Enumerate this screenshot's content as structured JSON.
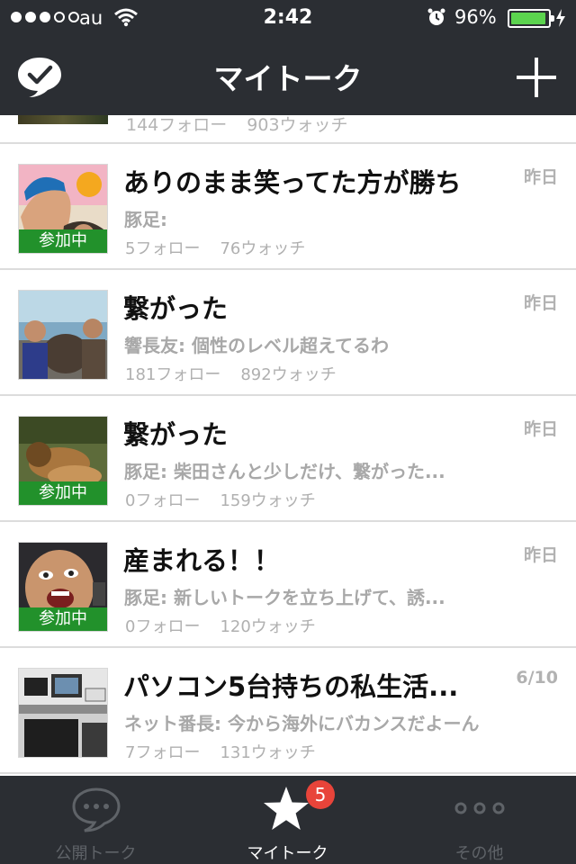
{
  "status_bar": {
    "carrier": "au",
    "time": "2:42",
    "battery_percent": "96%",
    "battery_level": 0.96,
    "signal_bars_filled": 3,
    "signal_bars_total": 5,
    "icons": [
      "wifi-icon",
      "alarm-icon",
      "charging-bolt-icon"
    ]
  },
  "nav_bar": {
    "title": "マイトーク",
    "left_icon": "check-bubble-icon",
    "right_icon": "plus-icon"
  },
  "partial_row": {
    "follow": "144フォロー",
    "watch": "903ウォッチ"
  },
  "talks": [
    {
      "title": "ありのまま笑ってた方が勝ち",
      "date": "昨日",
      "message": "豚足:",
      "follow": "5フォロー",
      "watch": "76ウォッチ",
      "badge": "参加中"
    },
    {
      "title": "繋がった",
      "date": "昨日",
      "message": "響長友: 個性のレベル超えてるわ",
      "follow": "181フォロー",
      "watch": "892ウォッチ",
      "badge": ""
    },
    {
      "title": "繋がった",
      "date": "昨日",
      "message": "豚足: 柴田さんと少しだけ、繋がった...",
      "follow": "0フォロー",
      "watch": "159ウォッチ",
      "badge": "参加中"
    },
    {
      "title": "産まれる！！",
      "date": "昨日",
      "message": "豚足: 新しいトークを立ち上げて、誘...",
      "follow": "0フォロー",
      "watch": "120ウォッチ",
      "badge": "参加中"
    },
    {
      "title": "パソコン5台持ちの私生活...",
      "date": "6/10",
      "message": "ネット番長: 今から海外にバカンスだよーん",
      "follow": "7フォロー",
      "watch": "131ウォッチ",
      "badge": ""
    }
  ],
  "tab_bar": {
    "tabs": [
      {
        "label": "公開トーク",
        "icon": "speech-bubble-icon",
        "active": false
      },
      {
        "label": "マイトーク",
        "icon": "star-icon",
        "active": true,
        "badge": "5"
      },
      {
        "label": "その他",
        "icon": "more-dots-icon",
        "active": false
      }
    ]
  },
  "colors": {
    "bar_background": "#2b2e33",
    "participating_badge": "#22912b",
    "notification_badge": "#e8443a",
    "battery_fill": "#5bd34e"
  }
}
